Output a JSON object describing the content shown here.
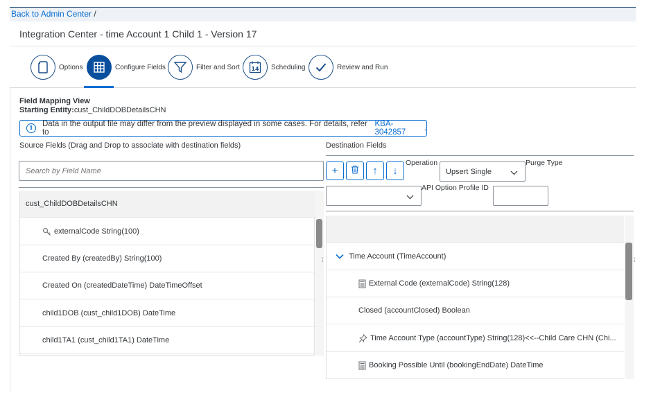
{
  "nav": {
    "back_label": "Back to Admin Center",
    "separator": "/"
  },
  "page": {
    "title": "Integration Center - time Account 1 Child 1 - Version 17"
  },
  "wizard": {
    "active_step": "Configure Fields",
    "steps": [
      {
        "label": "Options",
        "icon": "document-icon"
      },
      {
        "label": "Configure Fields",
        "icon": "grid-icon"
      },
      {
        "label": "Filter and Sort",
        "icon": "filter-icon"
      },
      {
        "label": "Scheduling",
        "icon": "calendar-icon",
        "icon_text": "14"
      },
      {
        "label": "Review and Run",
        "icon": "checkmark-icon"
      }
    ]
  },
  "mapping": {
    "view_title": "Field Mapping View",
    "entity_label": "Starting Entity:",
    "entity_value": "cust_ChildDOBDetailsCHN"
  },
  "info": {
    "message": "Data in the output file may differ from the preview displayed in some cases. For details, refer to ",
    "link": "KBA-3042857",
    "suffix": "."
  },
  "source": {
    "header": "Source Fields (Drag and Drop to associate with destination fields)",
    "search_placeholder": "Search by Field Name",
    "group": "cust_ChildDOBDetailsCHN",
    "fields": [
      {
        "label": "externalCode String(100)",
        "icon": "key-icon"
      },
      {
        "label": "Created By (createdBy) String(100)"
      },
      {
        "label": "Created On (createdDateTime) DateTimeOffset"
      },
      {
        "label": "child1DOB (cust_child1DOB) DateTime"
      },
      {
        "label": "child1TA1 (cust_child1TA1) DateTime"
      }
    ]
  },
  "destination": {
    "header": "Destination Fields",
    "toolbar": {
      "add": "+",
      "up": "↑",
      "down": "↓"
    },
    "operation_label": "Operation",
    "operation_value": "Upsert Single",
    "purge_label": "Purge Type",
    "purge_value": "",
    "api_profile_label": "API Option Profile ID",
    "api_profile_value": "",
    "group": "Time Account (TimeAccount)",
    "fields": [
      {
        "label": "External Code (externalCode) String(128)",
        "icon": "calculator-icon"
      },
      {
        "label": "Closed (accountClosed) Boolean"
      },
      {
        "label": "Time Account Type (accountType) String(128)<<--Child Care CHN (Chi...",
        "icon": "pin-icon"
      },
      {
        "label": "Booking Possible Until (bookingEndDate) DateTime",
        "icon": "calculator-icon"
      }
    ]
  },
  "colors": {
    "accent": "#0a6ed1",
    "active_step": "#0a4f9d",
    "text": "#32363a"
  }
}
